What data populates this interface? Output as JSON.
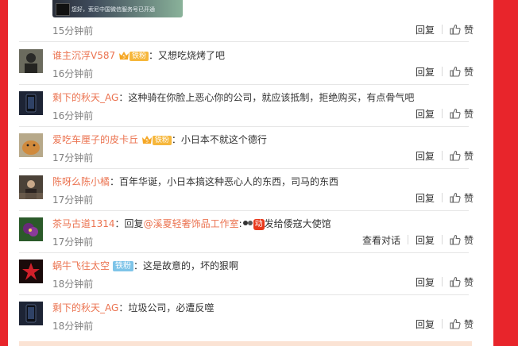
{
  "top_image": {
    "caption": "您好，索尼中国微信服务号已开通"
  },
  "first_time": "15分钟前",
  "actions": {
    "reply": "回复",
    "view_dialog": "查看对话",
    "like_count": "赞"
  },
  "colors": {
    "background": "#e8252b",
    "username": "#eb7350",
    "fans_badge": "#f6b73c",
    "iron_badge": "#7ec4e8"
  },
  "comments": [
    {
      "username": "谁主沉浮V587",
      "badge": "铁粉",
      "text": "：又想吃烧烤了吧",
      "time": "16分钟前",
      "avatar": "avatar-dark-person"
    },
    {
      "username": "剩下的秋天_AG",
      "text": "：这种骑在你脸上恶心你的公司，就应该抵制，拒绝购买，有点骨气吧",
      "time": "16分钟前",
      "avatar": "avatar-phone"
    },
    {
      "username": "爱吃车厘子的皮卡丘",
      "badge": "铁粉",
      "text": "：小日本不就这个德行",
      "time": "17分钟前",
      "avatar": "avatar-cat"
    },
    {
      "username": "陈呀么陈小橘",
      "text": "：百年华诞，小日本搞这种恶心人的东西，司马的东西",
      "time": "17分钟前",
      "avatar": "avatar-person"
    },
    {
      "username": "茶马古道1314",
      "text_prefix": "：回复",
      "mention": "@溪夏轻奢饰品工作室",
      "text_mid": ":",
      "gift": "动",
      "text": "发给倭寇大使馆",
      "time": "17分钟前",
      "avatar": "avatar-flower-purple"
    },
    {
      "username": "蜗牛飞往太空",
      "badge": "铁粉",
      "text": "：这是故意的，坏的狠啊",
      "time": "18分钟前",
      "avatar": "avatar-flower-red"
    },
    {
      "username": "剩下的秋天_AG",
      "text": "：垃圾公司，必遭反噬",
      "time": "18分钟前",
      "avatar": "avatar-phone"
    }
  ]
}
